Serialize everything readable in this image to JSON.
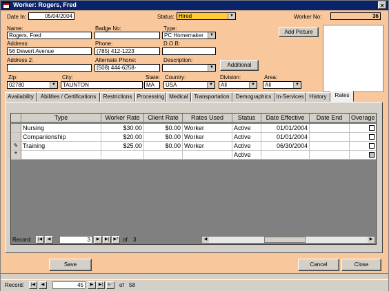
{
  "window": {
    "title": "Worker: Rogers, Fred",
    "close": "×"
  },
  "header": {
    "date_in_label": "Date In:",
    "date_in": "05/04/2004",
    "status_label": "Status:",
    "status": "Hired",
    "worker_no_label": "Worker No:",
    "worker_no": "36"
  },
  "form": {
    "name_label": "Name:",
    "name": "Rogers, Fred",
    "badge_label": "Badge No:",
    "badge": "",
    "type_label": "Type:",
    "type": "PC Homemaker",
    "address_label": "Address:",
    "address": "56 Dewert Avenue",
    "phone_label": "Phone:",
    "phone": "(785) 412-1223",
    "dob_label": "D.O.B:",
    "dob": "",
    "address2_label": "Address 2:",
    "address2": "",
    "alt_phone_label": "Alternate Phone:",
    "alt_phone": "(508) 444-6258-",
    "description_label": "Description:",
    "description": "",
    "zip_label": "Zip:",
    "zip": "02780",
    "city_label": "City:",
    "city": "TAUNTON",
    "state_label": "State:",
    "state": "MA",
    "country_label": "Country:",
    "country": "USA",
    "division_label": "Division:",
    "division": "All",
    "area_label": "Area:",
    "area": "All"
  },
  "buttons": {
    "add_picture": "Add Picture",
    "additional": "Additional",
    "save": "Save",
    "cancel": "Cancel",
    "close": "Close"
  },
  "tabs": [
    "Availability",
    "Abilities / Certifications",
    "Restrictions",
    "Processing",
    "Medical",
    "Transportation",
    "Demographics",
    "In-Services",
    "History",
    "Rates"
  ],
  "rates": {
    "columns": [
      "Type",
      "Worker Rate",
      "Client Rate",
      "Rates Used",
      "Status",
      "Date Effective",
      "Date End",
      "Overage A"
    ],
    "rows": [
      {
        "type": "Nursing",
        "worker_rate": "$30.00",
        "client_rate": "$0.00",
        "rates_used": "Worker",
        "status": "Active",
        "date_effective": "01/01/2004",
        "date_end": ""
      },
      {
        "type": "Companionship",
        "worker_rate": "$20.00",
        "client_rate": "$0.00",
        "rates_used": "Worker",
        "status": "Active",
        "date_effective": "01/01/2004",
        "date_end": ""
      },
      {
        "type": "Training",
        "worker_rate": "$25.00",
        "client_rate": "$0.00",
        "rates_used": "Worker",
        "status": "Active",
        "date_effective": "06/30/2004",
        "date_end": ""
      }
    ],
    "new_row_status": "Active",
    "edit_marker": "✎",
    "new_marker": "*"
  },
  "sub_nav": {
    "label": "Record:",
    "current": "3",
    "of": "of",
    "total": "3"
  },
  "main_nav": {
    "label": "Record:",
    "current": "45",
    "of": "of",
    "total": "58"
  },
  "colors": {
    "form_bg": "#f8c89c",
    "status_bg": "#ffcc33",
    "title_bg": "#0a246a"
  }
}
